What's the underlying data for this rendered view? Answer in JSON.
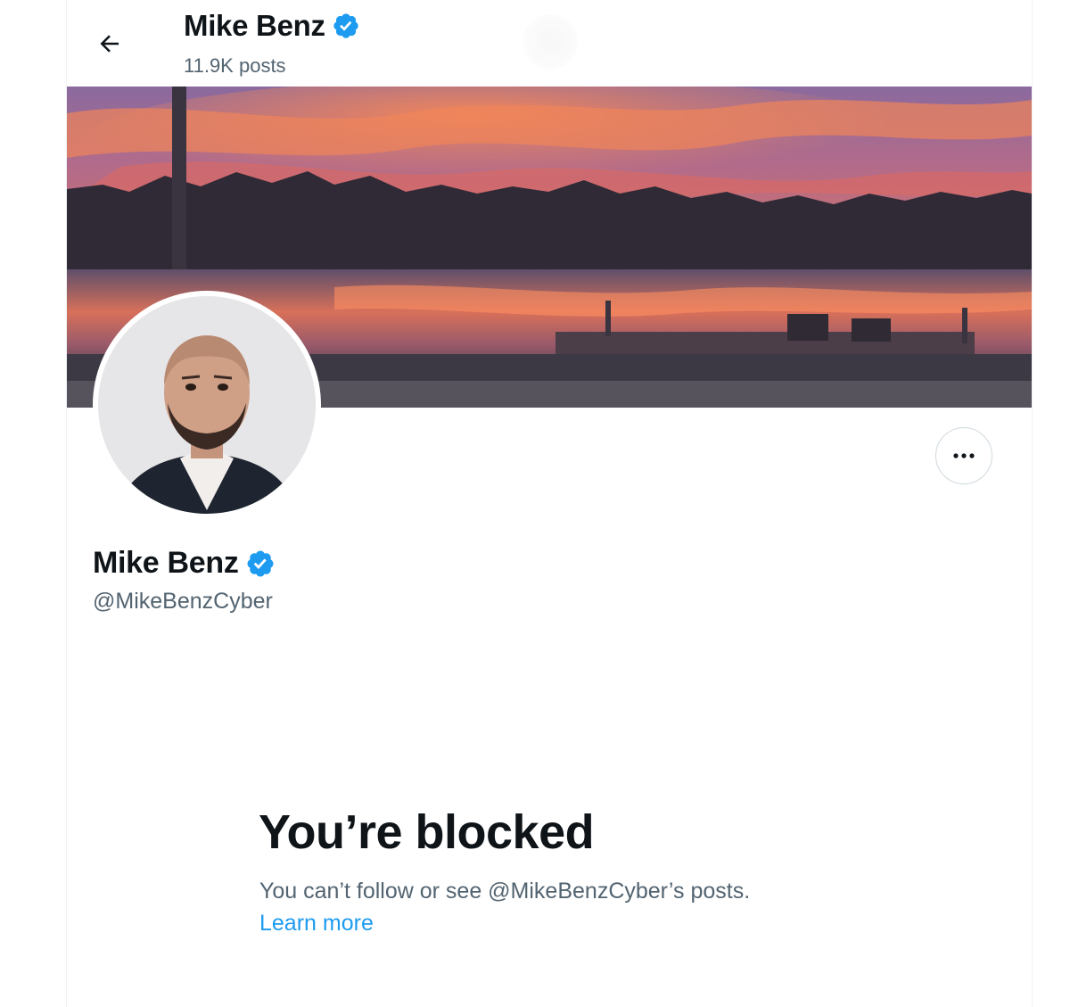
{
  "header": {
    "name": "Mike Benz",
    "posts_count": "11.9K posts",
    "back_icon": "arrow-left-icon"
  },
  "profile": {
    "name": "Mike Benz",
    "handle": "@MikeBenzCyber",
    "verified": true,
    "more_icon": "ellipsis-icon"
  },
  "blocked": {
    "title": "You’re blocked",
    "description": "You can’t follow or see @MikeBenzCyber’s posts.",
    "learn_more": "Learn more"
  },
  "colors": {
    "text_primary": "#0f1419",
    "text_secondary": "#536471",
    "link": "#1d9bf0",
    "verified_badge": "#1d9bf0",
    "border": "#cfd9de"
  }
}
